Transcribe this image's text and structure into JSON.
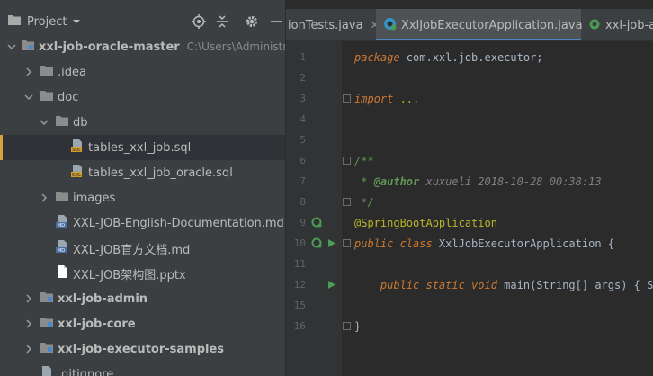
{
  "project_panel": {
    "title": "Project",
    "tree": [
      {
        "label": "xxl-job-oracle-master",
        "hint": "C:\\Users\\Administrator\\D",
        "icon": "module-folder",
        "expanded": true,
        "bold": true
      },
      {
        "label": ".idea",
        "icon": "folder",
        "expanded": false
      },
      {
        "label": "doc",
        "icon": "folder",
        "expanded": true
      },
      {
        "label": "db",
        "icon": "folder",
        "expanded": true
      },
      {
        "label": "tables_xxl_job.sql",
        "icon": "sql-file",
        "selected": true
      },
      {
        "label": "tables_xxl_job_oracle.sql",
        "icon": "sql-file"
      },
      {
        "label": "images",
        "icon": "folder",
        "expanded": false
      },
      {
        "label": "XXL-JOB-English-Documentation.md",
        "icon": "md-file"
      },
      {
        "label": "XXL-JOB官方文档.md",
        "icon": "md-file"
      },
      {
        "label": "XXL-JOB架构图.pptx",
        "icon": "pptx-file"
      },
      {
        "label": "xxl-job-admin",
        "icon": "module-folder",
        "expanded": false,
        "bold": true
      },
      {
        "label": "xxl-job-core",
        "icon": "module-folder",
        "expanded": false,
        "bold": true
      },
      {
        "label": "xxl-job-executor-samples",
        "icon": "module-folder",
        "expanded": false,
        "bold": true
      },
      {
        "label": ".gitignore",
        "icon": "text-file"
      }
    ]
  },
  "editor": {
    "tabs": [
      {
        "label": "ionTests.java",
        "active": false
      },
      {
        "label": "XxlJobExecutorApplication.java",
        "active": true
      },
      {
        "label": "xxl-job-ad",
        "active": false
      }
    ],
    "lines": [
      {
        "n": "1",
        "parts": [
          {
            "t": "package ",
            "c": "kw"
          },
          {
            "t": "com.xxl.job.executor;",
            "c": "pkg"
          }
        ]
      },
      {
        "n": "2",
        "parts": []
      },
      {
        "n": "3",
        "parts": [
          {
            "t": "import ",
            "c": "kw"
          },
          {
            "t": "...",
            "c": "anno"
          }
        ]
      },
      {
        "n": "4",
        "parts": []
      },
      {
        "n": "5",
        "parts": []
      },
      {
        "n": "6",
        "parts": [
          {
            "t": "/**",
            "c": "cm"
          }
        ]
      },
      {
        "n": "7",
        "parts": [
          {
            "t": " * ",
            "c": "cm"
          },
          {
            "t": "@author",
            "c": "tag"
          },
          {
            "t": " xuxueli 2018-10-28 00:38:13",
            "c": "cmt"
          }
        ]
      },
      {
        "n": "8",
        "parts": [
          {
            "t": " */",
            "c": "cm"
          }
        ]
      },
      {
        "n": "9",
        "parts": [
          {
            "t": "@SpringBootApplication",
            "c": "anno"
          }
        ]
      },
      {
        "n": "10",
        "parts": [
          {
            "t": "public class ",
            "c": "kw"
          },
          {
            "t": "XxlJobExecutorApplication ",
            "c": "cls"
          },
          {
            "t": "{",
            "c": "cls"
          }
        ]
      },
      {
        "n": "11",
        "parts": []
      },
      {
        "n": "12",
        "parts": [
          {
            "t": "    public static void ",
            "c": "kw"
          },
          {
            "t": "main(String[] args) { Spr",
            "c": "cls"
          }
        ]
      },
      {
        "n": "15",
        "parts": []
      },
      {
        "n": "16",
        "parts": [
          {
            "t": "}",
            "c": "cls"
          }
        ]
      }
    ]
  },
  "colors": {
    "accent": "#4a88c7",
    "selection_marker": "#d6a33b",
    "run_icon": "#499c54"
  }
}
